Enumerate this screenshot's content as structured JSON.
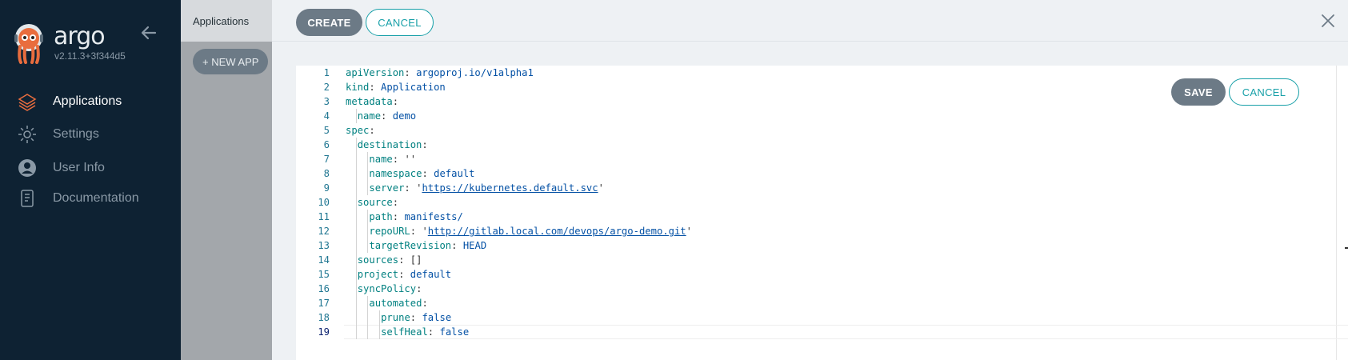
{
  "sidebar": {
    "brand": "argo",
    "version": "v2.11.3+3f344d5",
    "items": [
      {
        "label": "Applications",
        "icon": "layers-icon"
      },
      {
        "label": "Settings",
        "icon": "gear-icon"
      },
      {
        "label": "User Info",
        "icon": "user-icon"
      },
      {
        "label": "Documentation",
        "icon": "book-icon"
      }
    ]
  },
  "page": {
    "title": "Applications",
    "new_app_label": "+ NEW APP"
  },
  "panel": {
    "create_label": "CREATE",
    "cancel_label": "CANCEL",
    "save_label": "SAVE",
    "editor_cancel_label": "CANCEL",
    "current_line": 19
  },
  "editor": {
    "lines": [
      {
        "n": "1",
        "key": "apiVersion",
        "value": "argoproj.io/v1alpha1"
      },
      {
        "n": "2",
        "key": "kind",
        "value": "Application"
      },
      {
        "n": "3",
        "key": "metadata",
        "value": ""
      },
      {
        "n": "4",
        "key": "name",
        "value": "demo"
      },
      {
        "n": "5",
        "key": "spec",
        "value": ""
      },
      {
        "n": "6",
        "key": "destination",
        "value": ""
      },
      {
        "n": "7",
        "key": "name",
        "value": "''"
      },
      {
        "n": "8",
        "key": "namespace",
        "value": "default"
      },
      {
        "n": "9",
        "key": "server",
        "value": "https://kubernetes.default.svc"
      },
      {
        "n": "10",
        "key": "source",
        "value": ""
      },
      {
        "n": "11",
        "key": "path",
        "value": "manifests/"
      },
      {
        "n": "12",
        "key": "repoURL",
        "value": "http://gitlab.local.com/devops/argo-demo.git"
      },
      {
        "n": "13",
        "key": "targetRevision",
        "value": "HEAD"
      },
      {
        "n": "14",
        "key": "sources",
        "value": "[]"
      },
      {
        "n": "15",
        "key": "project",
        "value": "default"
      },
      {
        "n": "16",
        "key": "syncPolicy",
        "value": ""
      },
      {
        "n": "17",
        "key": "automated",
        "value": ""
      },
      {
        "n": "18",
        "key": "prune",
        "value": "false"
      },
      {
        "n": "19",
        "key": "selfHeal",
        "value": "false"
      }
    ]
  }
}
